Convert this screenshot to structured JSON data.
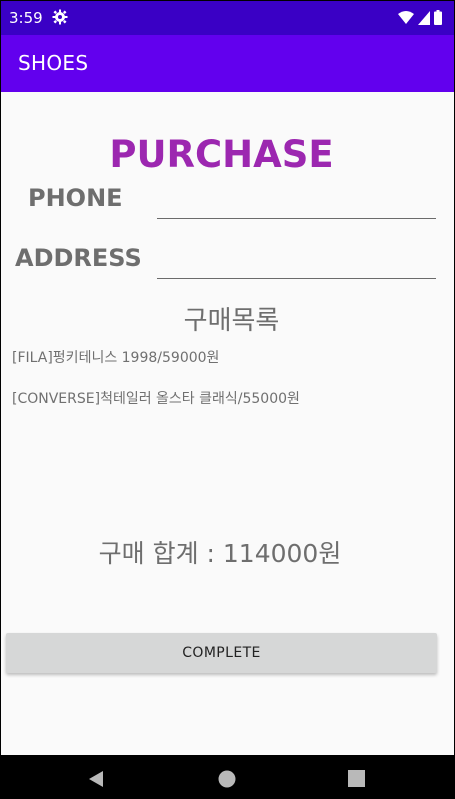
{
  "status_bar": {
    "time": "3:59",
    "icons": [
      "settings-gear-icon",
      "wifi-icon",
      "cell-signal-icon",
      "battery-icon"
    ]
  },
  "app_bar": {
    "title": "SHOES",
    "color": "#6200ee"
  },
  "purchase": {
    "title": "PURCHASE",
    "phone_label": "PHONE",
    "phone_value": "",
    "address_label": "ADDRESS",
    "address_value": "",
    "list_heading": "구매목록",
    "items": [
      "[FILA]펑키테니스 1998/59000원",
      "[CONVERSE]척테일러 올스타 클래식/55000원"
    ],
    "total": "구매 합계 : 114000원",
    "complete_label": "COMPLETE"
  },
  "nav_bar": {
    "buttons": [
      "back-icon",
      "home-icon",
      "recents-icon"
    ]
  },
  "colors": {
    "status_bar": "#3a00c5",
    "accent_title": "#9c27b0",
    "button": "#d6d7d7"
  }
}
